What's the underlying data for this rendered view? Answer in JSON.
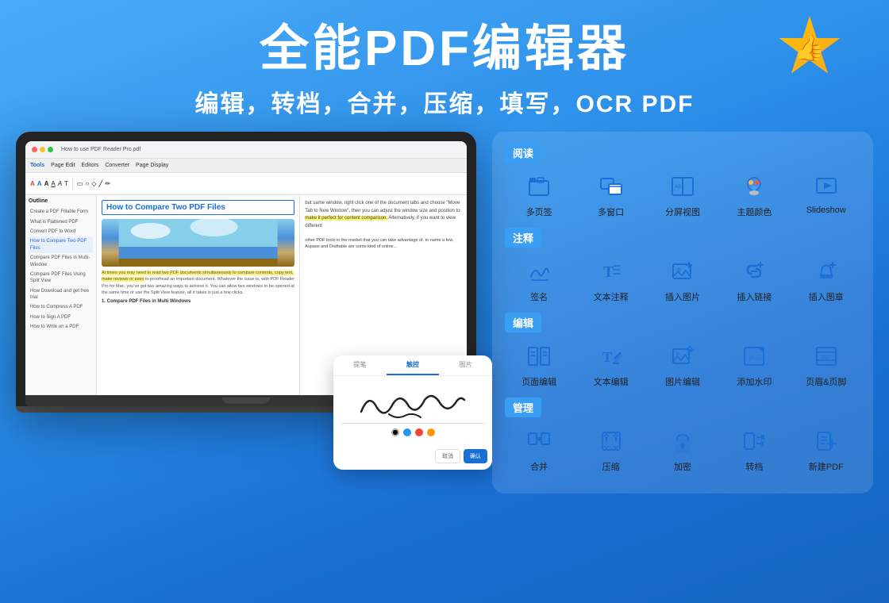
{
  "header": {
    "main_title": "全能PDF编辑器",
    "sub_title": "编辑，转档，合并，压缩，填写，OCR PDF",
    "badge_emoji": "👍"
  },
  "laptop": {
    "toolbar_title": "How to use PDF Reader Pro.pdf",
    "menu_items": [
      "Tools",
      "Page Edit",
      "Editors",
      "Converter",
      "Page Display"
    ],
    "article_title": "How to Compare Two PDF Files",
    "sidebar_title": "Outline",
    "sidebar_items": [
      "Create a PDF Fillable Form",
      "What is Flattened PDF",
      "Convert PDF to Word",
      "How to Compare Two PDF Files",
      "Compare PDF Files in Multi-Window",
      "Compare PDF Files Using Split View",
      "How Download and get free trial",
      "How to Compress A PDF",
      "How to Sign A PDF",
      "How to Write on a PDF"
    ],
    "right_text": "but same window, right click one of the document tabs and choose \"Move Tab to New Window\", then you can adjust the window size and position to make it perfect for content comparison. Alternatively, if you want to view different",
    "bottom_text": "1. Compare PDF Files in Multi Windows"
  },
  "floating_card": {
    "tabs": [
      "提笔",
      "触控",
      "图片"
    ],
    "active_tab": "触控",
    "signature_text": "R. Smith",
    "colors": [
      "#000000",
      "#2196f3",
      "#f44336",
      "#ff9800"
    ],
    "cancel_label": "取消",
    "confirm_label": "确认"
  },
  "features": {
    "sections": [
      {
        "label": "阅读",
        "items": [
          {
            "name": "多页签",
            "icon": "multi-tab"
          },
          {
            "name": "多窗口",
            "icon": "multi-window"
          },
          {
            "name": "分屏视图",
            "icon": "split-view"
          },
          {
            "name": "主题颜色",
            "icon": "theme-color"
          },
          {
            "name": "Slideshow",
            "icon": "slideshow"
          }
        ]
      },
      {
        "label": "注释",
        "items": [
          {
            "name": "签名",
            "icon": "signature"
          },
          {
            "name": "文本注释",
            "icon": "text-annotation"
          },
          {
            "name": "插入图片",
            "icon": "insert-image"
          },
          {
            "name": "插入链接",
            "icon": "insert-link"
          },
          {
            "name": "插入图章",
            "icon": "insert-stamp"
          }
        ]
      },
      {
        "label": "编辑",
        "items": [
          {
            "name": "页面编辑",
            "icon": "page-edit"
          },
          {
            "name": "文本编辑",
            "icon": "text-edit"
          },
          {
            "name": "图片编辑",
            "icon": "image-edit"
          },
          {
            "name": "添加水印",
            "icon": "watermark"
          },
          {
            "name": "页眉&页脚",
            "icon": "header-footer"
          }
        ]
      },
      {
        "label": "管理",
        "items": [
          {
            "name": "合并",
            "icon": "merge"
          },
          {
            "name": "压缩",
            "icon": "compress"
          },
          {
            "name": "加密",
            "icon": "encrypt"
          },
          {
            "name": "转档",
            "icon": "convert"
          },
          {
            "name": "新建PDF",
            "icon": "new-pdf"
          }
        ]
      }
    ]
  }
}
